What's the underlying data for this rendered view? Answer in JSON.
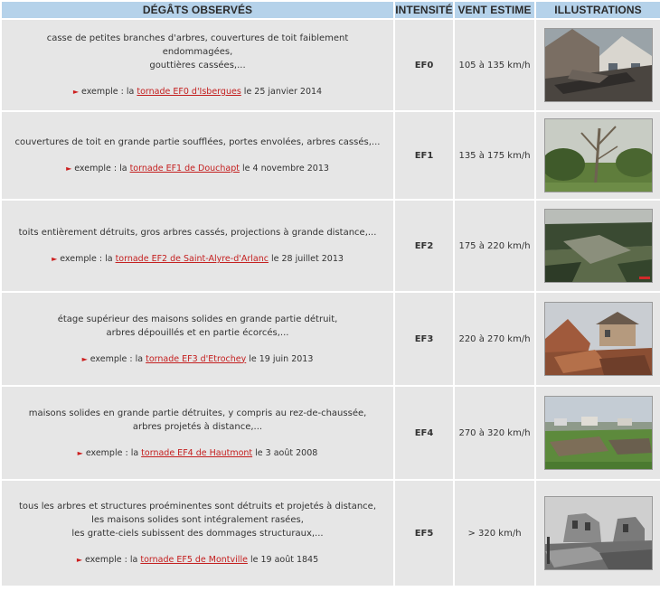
{
  "headers": {
    "damage": "DÉGÂTS OBSERVÉS",
    "intensity": "INTENSITÉ",
    "wind": "VENT ESTIME",
    "illustrations": "ILLUSTRATIONS"
  },
  "rows": [
    {
      "desc": [
        "casse de petites branches d'arbres, couvertures de toit faiblement endommagées,",
        "gouttières cassées,..."
      ],
      "example_prefix": "exemple : la ",
      "link": "tornade EF0 d'Isbergues",
      "example_suffix": " le 25 janvier 2014",
      "ef": "EF0",
      "wind": "105 à 135 km/h",
      "photo": "house-roof-damage"
    },
    {
      "desc": [
        "couvertures de toit en grande partie soufflées, portes envolées, arbres cassés,..."
      ],
      "example_prefix": "exemple : la ",
      "link": "tornade EF1 de Douchapt",
      "example_suffix": " le 4 novembre 2013",
      "ef": "EF1",
      "wind": "135 à 175 km/h",
      "photo": "broken-trees-field"
    },
    {
      "desc": [
        "toits entièrement détruits, gros arbres cassés, projections à grande distance,..."
      ],
      "example_prefix": "exemple : la ",
      "link": "tornade EF2 de Saint-Alyre-d'Arlanc",
      "example_suffix": " le 28 juillet 2013",
      "ef": "EF2",
      "wind": "175 à 220 km/h",
      "photo": "forest-damage-aerial"
    },
    {
      "desc": [
        "étage supérieur des maisons solides en grande partie détruit,",
        "arbres dépouillés et en partie écorcés,..."
      ],
      "example_prefix": "exemple : la ",
      "link": "tornade EF3 d'Etrochey",
      "example_suffix": " le 19 juin 2013",
      "ef": "EF3",
      "wind": "220 à 270 km/h",
      "photo": "collapsed-brick-house"
    },
    {
      "desc": [
        "maisons solides en grande partie détruites, y compris au rez-de-chaussée,",
        "arbres projetés à distance,..."
      ],
      "example_prefix": "exemple : la ",
      "link": "tornade EF4 de Hautmont",
      "example_suffix": " le 3 août 2008",
      "ef": "EF4",
      "wind": "270 à 320 km/h",
      "photo": "debris-field-town"
    },
    {
      "desc": [
        "tous les arbres et structures proéminentes sont détruits et projetés à distance,",
        "les maisons solides sont intégralement rasées,",
        "les gratte-ciels subissent des dommages structuraux,..."
      ],
      "example_prefix": "exemple : la ",
      "link": "tornade EF5 de Montville",
      "example_suffix": " le 19 août 1845",
      "ef": "EF5",
      "wind": "> 320 km/h",
      "photo": "ruined-building-bw"
    }
  ]
}
